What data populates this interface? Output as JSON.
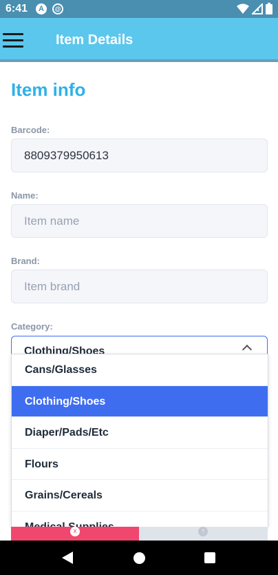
{
  "status": {
    "time": "6:41"
  },
  "appbar": {
    "title": "Item Details"
  },
  "form": {
    "section_title": "Item info",
    "barcode": {
      "label": "Barcode:",
      "value": "8809379950613"
    },
    "name": {
      "label": "Name:",
      "placeholder": "Item name"
    },
    "brand": {
      "label": "Brand:",
      "placeholder": "Item brand"
    },
    "category": {
      "label": "Category:",
      "selected": "Clothing/Shoes"
    }
  },
  "dropdown": {
    "options": [
      "Cans/Glasses",
      "Clothing/Shoes",
      "Diaper/Pads/Etc",
      "Flours",
      "Grains/Cereals",
      "Medical Supplies"
    ],
    "selected_index": 1
  },
  "colors": {
    "appbar": "#5bc7ed",
    "accent": "#2fb1e8",
    "selected": "#3f6df0",
    "cancel": "#f0476f"
  }
}
